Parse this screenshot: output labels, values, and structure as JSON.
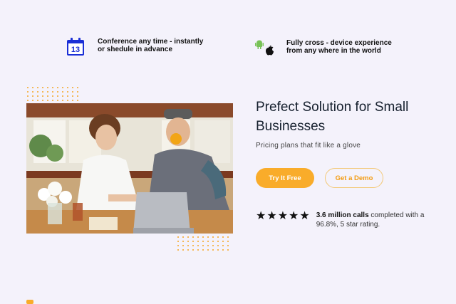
{
  "features": [
    {
      "icon": "calendar-icon",
      "text": "Conference any time - instantly or shedule in advance",
      "calendar_day": "13"
    },
    {
      "icon": "android-apple-icons",
      "text": "Fully cross - device experience from any where in the world"
    }
  ],
  "hero": {
    "title": "Prefect Solution for Small Businesses",
    "subtitle": "Pricing plans that fit like a glove",
    "primary_button": "Try It Free",
    "secondary_button": "Get a Demo"
  },
  "rating": {
    "stars": 5,
    "highlight": "3.6 million calls",
    "rest": " completed with a 96.8%, 5 star rating."
  },
  "colors": {
    "accent": "#f9ac2a",
    "calendar_blue": "#1a2fd6",
    "android_green": "#78c257",
    "background": "#f4f2fb"
  }
}
